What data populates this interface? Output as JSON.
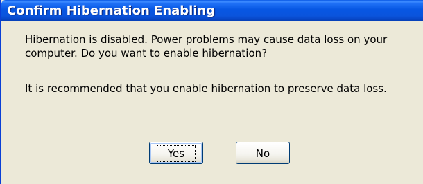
{
  "dialog": {
    "title": "Confirm Hibernation Enabling",
    "message_line1": "Hibernation is disabled. Power problems may cause data loss on your computer. Do you want to enable hibernation?",
    "message_line2": "It is recommended that you enable hibernation to preserve data loss.",
    "buttons": {
      "yes_label": "Yes",
      "no_label": "No",
      "default": "Yes"
    }
  },
  "colors": {
    "titlebar": "#0757e3",
    "face": "#ece9d8",
    "button_border": "#003c74"
  }
}
